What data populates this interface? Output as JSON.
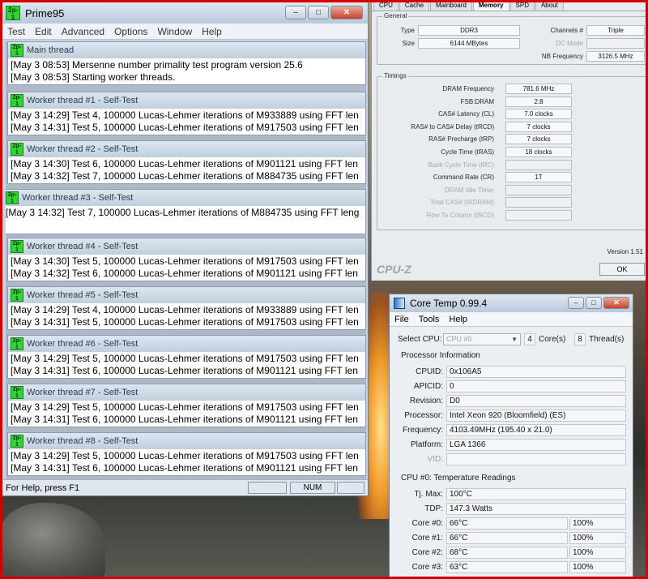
{
  "prime95": {
    "title": "Prime95",
    "menu": [
      "Test",
      "Edit",
      "Advanced",
      "Options",
      "Window",
      "Help"
    ],
    "icon_text": "2p-1",
    "threads": [
      {
        "title": "Main thread",
        "lines": [
          "[May 3 08:53] Mersenne number primality test program version 25.6",
          "[May 3 08:53] Starting worker threads."
        ]
      },
      {
        "title": "Worker thread #1 - Self-Test",
        "lines": [
          "[May 3 14:29] Test 4, 100000 Lucas-Lehmer iterations of M933889 using FFT len",
          "[May 3 14:31] Test 5, 100000 Lucas-Lehmer iterations of M917503 using FFT len"
        ]
      },
      {
        "title": "Worker thread #2 - Self-Test",
        "lines": [
          "[May 3 14:30] Test 6, 100000 Lucas-Lehmer iterations of M901121 using FFT len",
          "[May 3 14:32] Test 7, 100000 Lucas-Lehmer iterations of M884735 using FFT len"
        ]
      },
      {
        "title": "Worker thread #3 - Self-Test",
        "lines": [
          "[May 3 14:32] Test 7, 100000 Lucas-Lehmer iterations of M884735 using FFT leng"
        ]
      },
      {
        "title": "Worker thread #4 - Self-Test",
        "lines": [
          "[May 3 14:30] Test 5, 100000 Lucas-Lehmer iterations of M917503 using FFT len",
          "[May 3 14:32] Test 6, 100000 Lucas-Lehmer iterations of M901121 using FFT len"
        ]
      },
      {
        "title": "Worker thread #5 - Self-Test",
        "lines": [
          "[May 3 14:29] Test 4, 100000 Lucas-Lehmer iterations of M933889 using FFT len",
          "[May 3 14:31] Test 5, 100000 Lucas-Lehmer iterations of M917503 using FFT len"
        ]
      },
      {
        "title": "Worker thread #6 - Self-Test",
        "lines": [
          "[May 3 14:29] Test 5, 100000 Lucas-Lehmer iterations of M917503 using FFT len",
          "[May 3 14:31] Test 6, 100000 Lucas-Lehmer iterations of M901121 using FFT len"
        ]
      },
      {
        "title": "Worker thread #7 - Self-Test",
        "lines": [
          "[May 3 14:29] Test 5, 100000 Lucas-Lehmer iterations of M917503 using FFT len",
          "[May 3 14:31] Test 6, 100000 Lucas-Lehmer iterations of M901121 using FFT len"
        ]
      },
      {
        "title": "Worker thread #8 - Self-Test",
        "lines": [
          "[May 3 14:29] Test 5, 100000 Lucas-Lehmer iterations of M917503 using FFT len",
          "[May 3 14:31] Test 6, 100000 Lucas-Lehmer iterations of M901121 using FFT len"
        ]
      }
    ],
    "status_text": "For Help, press F1",
    "status_num": "NUM"
  },
  "cpuz": {
    "tabs": [
      "CPU",
      "Cache",
      "Mainboard",
      "Memory",
      "SPD",
      "About"
    ],
    "active_tab": "Memory",
    "general_label": "General",
    "type_label": "Type",
    "type_value": "DDR3",
    "size_label": "Size",
    "size_value": "6144 MBytes",
    "channels_label": "Channels #",
    "channels_value": "Triple",
    "dcmode_label": "DC Mode",
    "nbfreq_label": "NB Frequency",
    "nbfreq_value": "3126.5 MHz",
    "timings_label": "Timings",
    "timings": [
      {
        "label": "DRAM Frequency",
        "value": "781.6 MHz",
        "dim": false
      },
      {
        "label": "FSB:DRAM",
        "value": "2:8",
        "dim": false
      },
      {
        "label": "CAS# Latency (CL)",
        "value": "7.0 clocks",
        "dim": false
      },
      {
        "label": "RAS# to CAS# Delay (tRCD)",
        "value": "7 clocks",
        "dim": false
      },
      {
        "label": "RAS# Precharge (tRP)",
        "value": "7 clocks",
        "dim": false
      },
      {
        "label": "Cycle Time (tRAS)",
        "value": "18 clocks",
        "dim": false
      },
      {
        "label": "Bank Cycle Time (tRC)",
        "value": "",
        "dim": true
      },
      {
        "label": "Command Rate (CR)",
        "value": "1T",
        "dim": false
      },
      {
        "label": "DRAM Idle Timer",
        "value": "",
        "dim": true
      },
      {
        "label": "Total CAS# (tRDRAM)",
        "value": "",
        "dim": true
      },
      {
        "label": "Row To Column (tRCD)",
        "value": "",
        "dim": true
      }
    ],
    "brand": "CPU-Z",
    "version": "Version 1.51",
    "ok_label": "OK"
  },
  "coretemp": {
    "title": "Core Temp 0.99.4",
    "menu": [
      "File",
      "Tools",
      "Help"
    ],
    "select_cpu_label": "Select CPU:",
    "select_cpu_value": "CPU #0",
    "cores_value": "4",
    "cores_label": "Core(s)",
    "threads_value": "8",
    "threads_label": "Thread(s)",
    "processor_info_label": "Processor Information",
    "info": [
      {
        "label": "CPUID:",
        "value": "0x106A5",
        "dim": false
      },
      {
        "label": "APICID:",
        "value": "0",
        "dim": false
      },
      {
        "label": "Revision:",
        "value": "D0",
        "dim": false
      },
      {
        "label": "Processor:",
        "value": "Intel Xeon 920 (Bloomfield) (ES)",
        "dim": false
      },
      {
        "label": "Frequency:",
        "value": "4103.49MHz (195.40 x 21.0)",
        "dim": false
      },
      {
        "label": "Platform:",
        "value": "LGA 1366",
        "dim": false
      },
      {
        "label": "VID:",
        "value": "",
        "dim": true
      }
    ],
    "temp_section_label": "CPU #0: Temperature Readings",
    "tjmax_label": "Tj. Max:",
    "tjmax_value": "100°C",
    "tdp_label": "TDP:",
    "tdp_value": "147.3 Watts",
    "cores": [
      {
        "label": "Core #0:",
        "temp": "66°C",
        "load": "100%"
      },
      {
        "label": "Core #1:",
        "temp": "66°C",
        "load": "100%"
      },
      {
        "label": "Core #2:",
        "temp": "68°C",
        "load": "100%"
      },
      {
        "label": "Core #3:",
        "temp": "63°C",
        "load": "100%"
      }
    ]
  }
}
